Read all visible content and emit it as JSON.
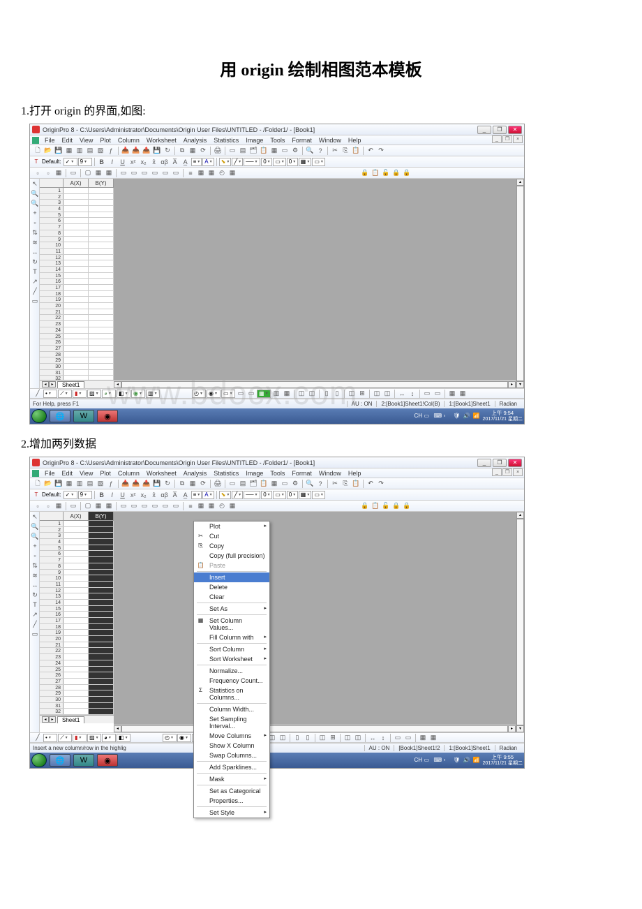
{
  "doc": {
    "title": "用 origin 绘制相图范本模板",
    "step1": "1.打开 origin 的界面,如图:",
    "step2": "2.增加两列数据"
  },
  "app": {
    "title": "OriginPro 8 - C:\\Users\\Administrator\\Documents\\Origin User Files\\UNTITLED - /Folder1/ - [Book1]",
    "menus": [
      "File",
      "Edit",
      "View",
      "Plot",
      "Column",
      "Worksheet",
      "Analysis",
      "Statistics",
      "Image",
      "Tools",
      "Format",
      "Window",
      "Help"
    ],
    "font_label": "Default:",
    "font_size": "9",
    "columns": {
      "a": "A(X)",
      "b": "B(Y)"
    },
    "row_count": 32,
    "sheet_tab": "Sheet1",
    "status1": {
      "left": "For Help, press F1",
      "au": "AU : ON",
      "seg1": "2:[Book1]Sheet1!Col(B)",
      "seg2": "1:[Book1]Sheet1",
      "seg3": "Radian"
    },
    "status2": {
      "left": "Insert a new column/row in the highlig",
      "au": "AU : ON",
      "seg1": "[Book1]Sheet1!2",
      "seg2": "1:[Book1]Sheet1",
      "seg3": "Radian"
    },
    "taskbar": {
      "clock1": {
        "time": "上午 9:54",
        "date": "2017/11/21 星期二"
      },
      "clock2": {
        "time": "上午 9:55",
        "date": "2017/11/21 星期二"
      }
    }
  },
  "context_menu": {
    "items": [
      {
        "label": "Plot",
        "sub": true
      },
      {
        "label": "Cut",
        "icon": "✂"
      },
      {
        "label": "Copy",
        "icon": "⎘"
      },
      {
        "label": "Copy (full precision)"
      },
      {
        "label": "Paste",
        "icon": "📋",
        "disabled": true
      },
      {
        "sep": true
      },
      {
        "label": "Insert",
        "hover": true
      },
      {
        "label": "Delete"
      },
      {
        "label": "Clear"
      },
      {
        "sep": true
      },
      {
        "label": "Set As",
        "sub": true
      },
      {
        "sep": true
      },
      {
        "label": "Set Column Values...",
        "icon": "▦"
      },
      {
        "label": "Fill Column with",
        "sub": true
      },
      {
        "sep": true
      },
      {
        "label": "Sort Column",
        "sub": true
      },
      {
        "label": "Sort Worksheet",
        "sub": true
      },
      {
        "sep": true
      },
      {
        "label": "Normalize..."
      },
      {
        "label": "Frequency Count..."
      },
      {
        "label": "Statistics on Columns...",
        "icon": "Σ"
      },
      {
        "sep": true
      },
      {
        "label": "Column Width..."
      },
      {
        "label": "Set Sampling Interval..."
      },
      {
        "label": "Move Columns",
        "sub": true
      },
      {
        "label": "Show X Column"
      },
      {
        "label": "Swap Columns..."
      },
      {
        "sep": true
      },
      {
        "label": "Add Sparklines..."
      },
      {
        "sep": true
      },
      {
        "label": "Mask",
        "sub": true
      },
      {
        "sep": true
      },
      {
        "label": "Set as Categorical"
      },
      {
        "label": "Properties..."
      },
      {
        "sep": true
      },
      {
        "label": "Set Style",
        "sub": true
      }
    ]
  },
  "watermark": "www.bdocx.com"
}
